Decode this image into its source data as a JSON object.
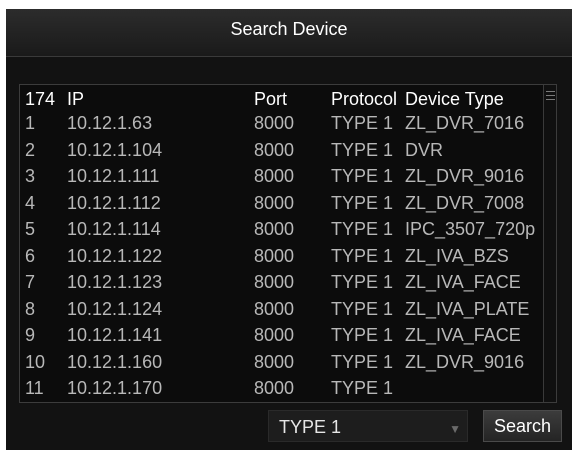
{
  "dialog": {
    "title": "Search Device"
  },
  "table": {
    "columns": {
      "count": "174",
      "ip": "IP",
      "port": "Port",
      "protocol": "Protocol",
      "device_type": "Device Type"
    },
    "rows": [
      {
        "no": "1",
        "ip": "10.12.1.63",
        "port": "8000",
        "protocol": "TYPE 1",
        "device_type": "ZL_DVR_7016"
      },
      {
        "no": "2",
        "ip": "10.12.1.104",
        "port": "8000",
        "protocol": "TYPE 1",
        "device_type": "DVR"
      },
      {
        "no": "3",
        "ip": "10.12.1.111",
        "port": "8000",
        "protocol": "TYPE 1",
        "device_type": "ZL_DVR_9016"
      },
      {
        "no": "4",
        "ip": "10.12.1.112",
        "port": "8000",
        "protocol": "TYPE 1",
        "device_type": "ZL_DVR_7008"
      },
      {
        "no": "5",
        "ip": "10.12.1.114",
        "port": "8000",
        "protocol": "TYPE 1",
        "device_type": "IPC_3507_720p"
      },
      {
        "no": "6",
        "ip": "10.12.1.122",
        "port": "8000",
        "protocol": "TYPE 1",
        "device_type": "ZL_IVA_BZS"
      },
      {
        "no": "7",
        "ip": "10.12.1.123",
        "port": "8000",
        "protocol": "TYPE 1",
        "device_type": "ZL_IVA_FACE"
      },
      {
        "no": "8",
        "ip": "10.12.1.124",
        "port": "8000",
        "protocol": "TYPE 1",
        "device_type": "ZL_IVA_PLATE"
      },
      {
        "no": "9",
        "ip": "10.12.1.141",
        "port": "8000",
        "protocol": "TYPE 1",
        "device_type": "ZL_IVA_FACE"
      },
      {
        "no": "10",
        "ip": "10.12.1.160",
        "port": "8000",
        "protocol": "TYPE 1",
        "device_type": "ZL_DVR_9016"
      },
      {
        "no": "11",
        "ip": "10.12.1.170",
        "port": "8000",
        "protocol": "TYPE 1",
        "device_type": ""
      }
    ]
  },
  "footer": {
    "protocol_selected": "TYPE 1",
    "search_label": "Search"
  }
}
